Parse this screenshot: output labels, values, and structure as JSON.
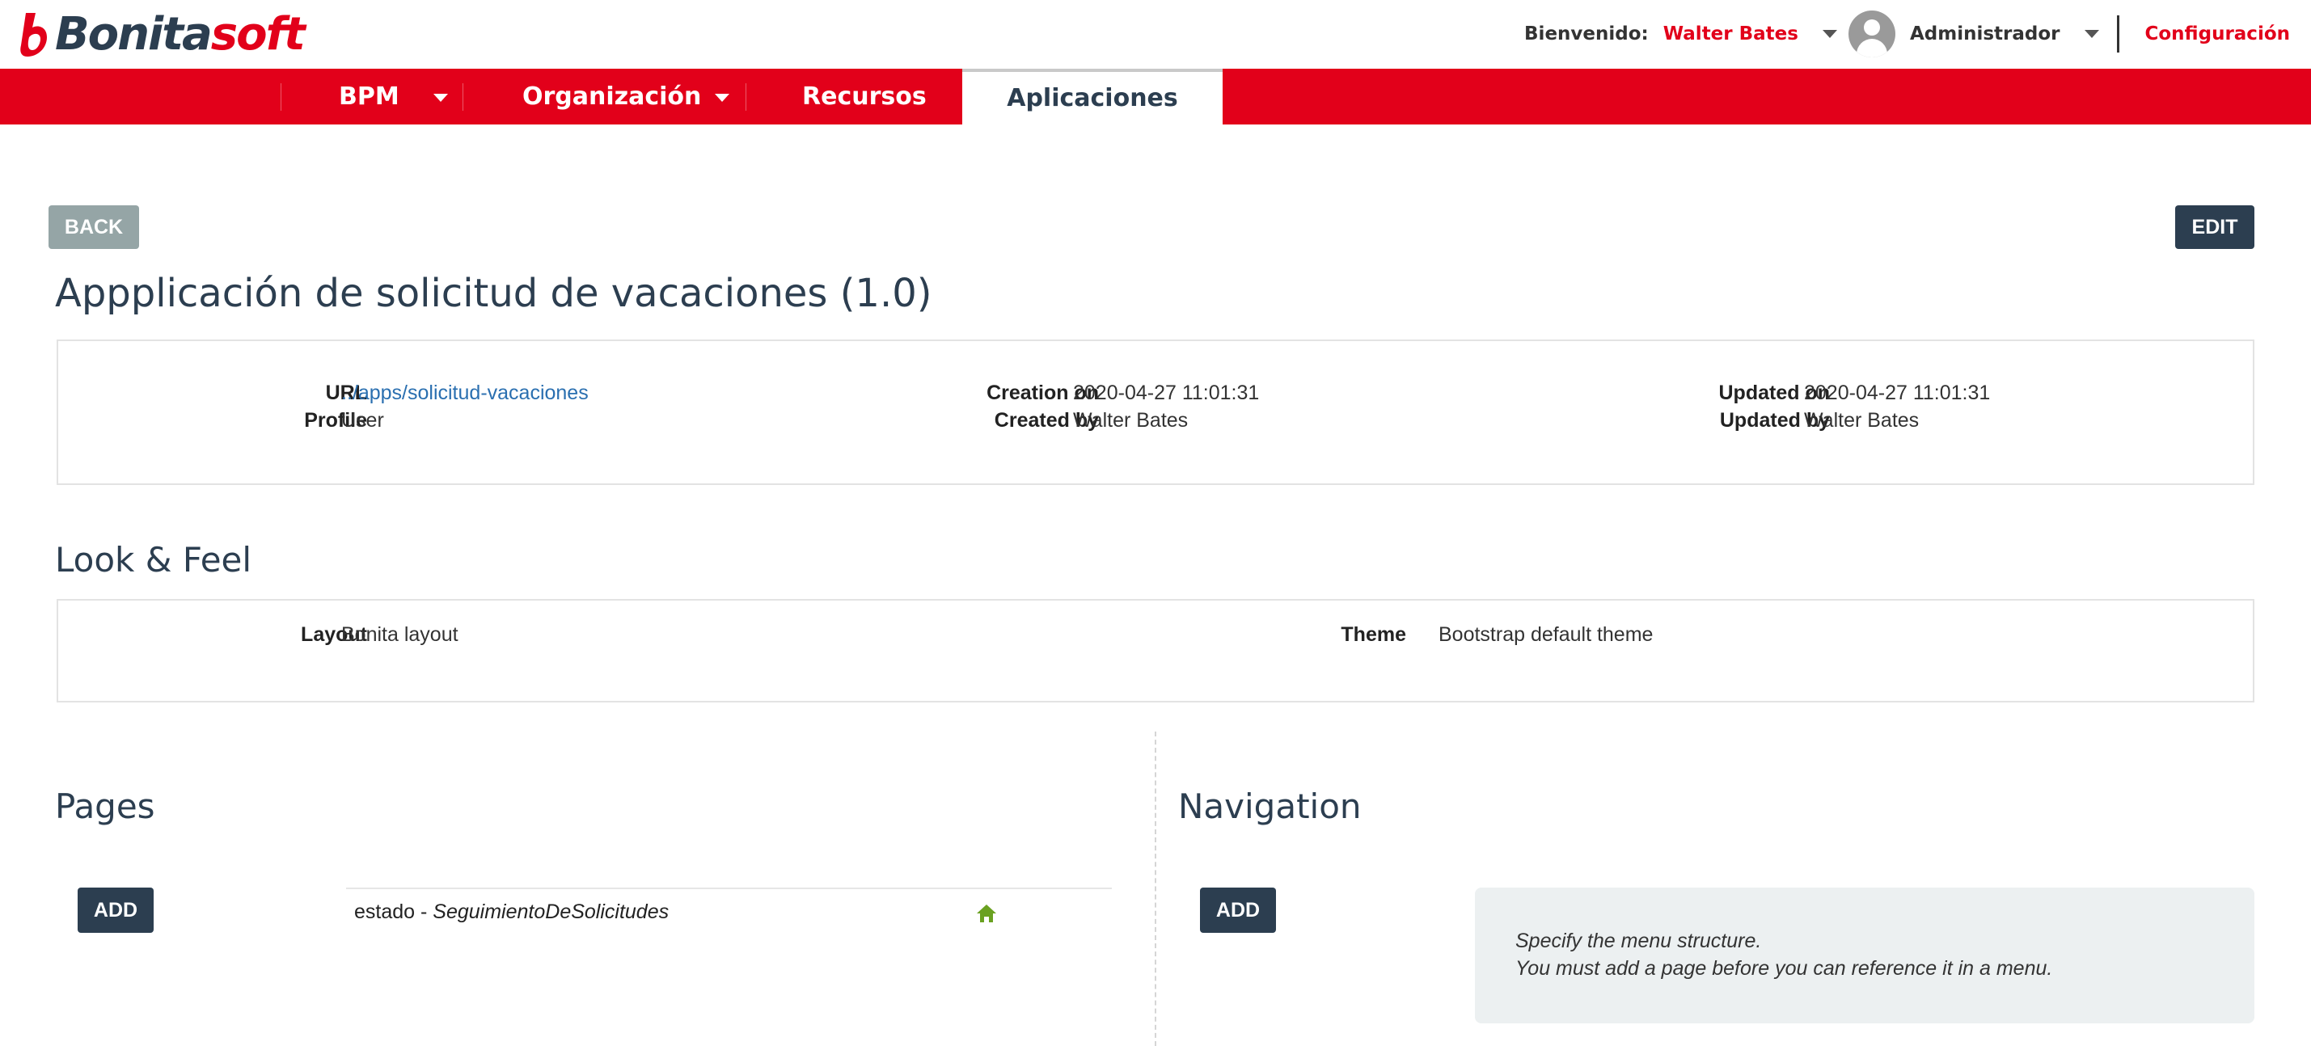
{
  "header": {
    "logo_left": "Bonita",
    "logo_right": "soft",
    "welcome_label": "Bienvenido:",
    "user_name": "Walter Bates",
    "profile": "Administrador",
    "config_label": "Configuración"
  },
  "nav": {
    "items": [
      {
        "label": "BPM",
        "dropdown": true
      },
      {
        "label": "Organización",
        "dropdown": true
      },
      {
        "label": "Recursos",
        "dropdown": false
      },
      {
        "label": "Aplicaciones",
        "dropdown": false,
        "active": true
      }
    ]
  },
  "toolbar": {
    "back_label": "BACK",
    "edit_label": "EDIT"
  },
  "app": {
    "title": "Appplicación de solicitud de vacaciones (1.0)",
    "url_label": "URL",
    "url_value": "../apps/solicitud-vacaciones",
    "profile_label": "Profile",
    "profile_value": "User",
    "creation_on_label": "Creation on",
    "creation_on_value": "2020-04-27 11:01:31",
    "created_by_label": "Created by",
    "created_by_value": "Walter Bates",
    "updated_on_label": "Updated on",
    "updated_on_value": "2020-04-27 11:01:31",
    "updated_by_label": "Updated by",
    "updated_by_value": "Walter Bates"
  },
  "look_feel": {
    "heading": "Look & Feel",
    "layout_label": "Layout",
    "layout_value": "Bonita layout",
    "theme_label": "Theme",
    "theme_value": "Bootstrap default theme"
  },
  "pages": {
    "heading": "Pages",
    "add_label": "ADD",
    "rows": [
      {
        "token": "estado",
        "separator": " - ",
        "page_name": "SeguimientoDeSolicitudes",
        "is_home": true
      }
    ]
  },
  "navigation": {
    "heading": "Navigation",
    "add_label": "ADD",
    "info_line1": "Specify the menu structure.",
    "info_line2": "You must add a page before you can reference it in a menu."
  },
  "colors": {
    "brand_red": "#e2001a",
    "dark_blue": "#2c3e50",
    "home_green": "#6aa121"
  },
  "icons": {
    "avatar": "user-avatar-icon",
    "caret": "caret-down-icon",
    "home": "home-icon"
  }
}
